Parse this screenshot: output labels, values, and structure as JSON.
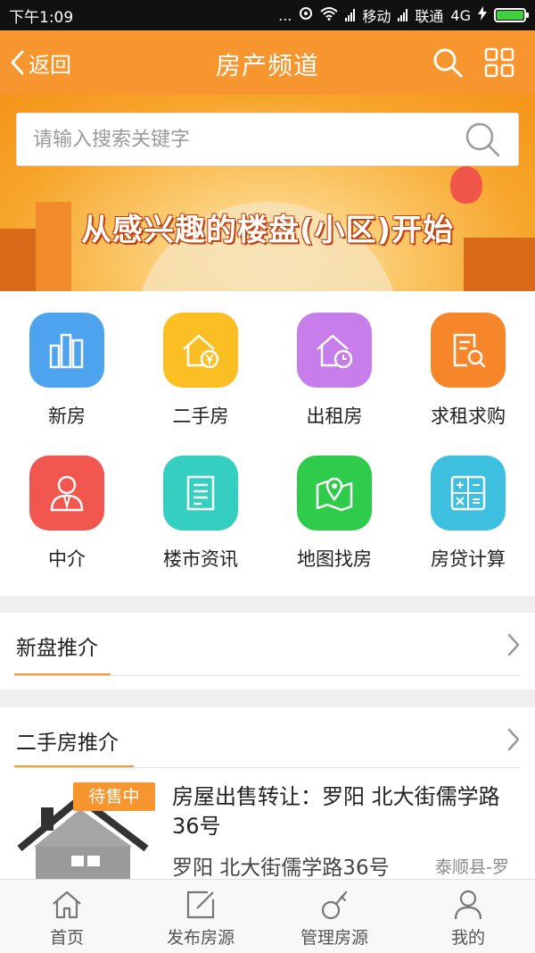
{
  "status_bar": {
    "time": "下午1:09",
    "dots": "...",
    "carrier1": "移动",
    "carrier2": "联通",
    "network": "4G"
  },
  "nav": {
    "back_label": "返回",
    "title": "房产频道",
    "icons": [
      "search-icon",
      "grid-menu-icon"
    ]
  },
  "banner": {
    "search_placeholder": "请输入搜索关键字",
    "slogan": "从感兴趣的楼盘(小区)开始"
  },
  "shortcuts": [
    {
      "label": "新房",
      "icon": "buildings-icon",
      "color": "#4ea3ef"
    },
    {
      "label": "二手房",
      "icon": "house-yen-icon",
      "color": "#fbbf24"
    },
    {
      "label": "出租房",
      "icon": "house-clock-icon",
      "color": "#c77dea"
    },
    {
      "label": "求租求购",
      "icon": "document-search-icon",
      "color": "#f7862a"
    },
    {
      "label": "中介",
      "icon": "agent-icon",
      "color": "#f2574f"
    },
    {
      "label": "楼市资讯",
      "icon": "news-document-icon",
      "color": "#34cfc1"
    },
    {
      "label": "地图找房",
      "icon": "map-pin-icon",
      "color": "#2fcb4a"
    },
    {
      "label": "房贷计算",
      "icon": "calculator-icon",
      "color": "#3dbfe0"
    }
  ],
  "sections": {
    "new_homes": {
      "title": "新盘推介"
    },
    "second_hand": {
      "title": "二手房推介"
    }
  },
  "listing": {
    "badge": "待售中",
    "title": "房屋出售转让：罗阳 北大街儒学路36号",
    "address": "罗阳 北大街儒学路36号",
    "district": "泰顺县-罗"
  },
  "tabbar": [
    {
      "label": "首页",
      "icon": "home-icon"
    },
    {
      "label": "发布房源",
      "icon": "edit-icon"
    },
    {
      "label": "管理房源",
      "icon": "key-icon"
    },
    {
      "label": "我的",
      "icon": "user-icon"
    }
  ],
  "colors": {
    "accent": "#f7952e",
    "status_bar": "#111111",
    "battery": "#3fcf3f"
  }
}
